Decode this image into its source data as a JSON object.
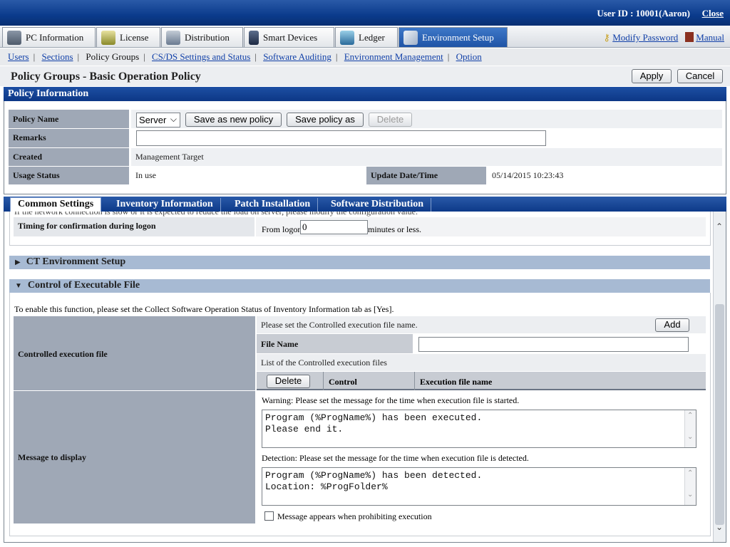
{
  "topbar": {
    "user_id": "User ID : 10001(Aaron)",
    "close": "Close"
  },
  "mainnav": {
    "tabs": [
      {
        "label": "PC Information",
        "icon": "pc-icon",
        "color": "#5a6a80"
      },
      {
        "label": "License",
        "icon": "license-icon",
        "color": "#7a8a2a"
      },
      {
        "label": "Distribution",
        "icon": "distribution-icon",
        "color": "#6a7a90"
      },
      {
        "label": "Smart Devices",
        "icon": "smart-device-icon",
        "color": "#2a3a5a"
      },
      {
        "label": "Ledger",
        "icon": "ledger-icon",
        "color": "#3a7aa8"
      },
      {
        "label": "Environment Setup",
        "icon": "tools-icon",
        "color": "#d8dde6"
      }
    ],
    "modify_password": "Modify Password",
    "manual": "Manual"
  },
  "subnav": {
    "items": [
      "Users",
      "Sections",
      "Policy Groups",
      "CS/DS Settings and Status",
      "Software Auditing",
      "Environment Management",
      "Option"
    ],
    "current": "Policy Groups"
  },
  "page": {
    "title": "Policy Groups - Basic Operation Policy",
    "apply": "Apply",
    "cancel": "Cancel"
  },
  "policy_info": {
    "header": "Policy Information",
    "policy_name_label": "Policy Name",
    "policy_name_value": "Server",
    "save_new": "Save as new policy",
    "save_as": "Save policy as",
    "delete": "Delete",
    "remarks_label": "Remarks",
    "remarks_value": "",
    "created_label": "Created",
    "created_value": "Management Target",
    "usage_label": "Usage Status",
    "usage_value": "In use",
    "update_label": "Update Date/Time",
    "update_value": "05/14/2015 10:23:43"
  },
  "tabs": [
    "Common Settings",
    "Inventory Information",
    "Patch Installation",
    "Software Distribution"
  ],
  "content": {
    "cut_text": "If the network connection is slow or it is expected to reduce the load on server, please modify the configuration value.",
    "timing_label": "Timing for confirmation during logon",
    "timing_prefix": "From logon",
    "timing_value": "0",
    "timing_suffix": "minutes or less.",
    "ct_env_header": "CT Environment Setup",
    "control_header": "Control of Executable File",
    "enable_note": "To enable this function, please set the Collect Software Operation Status of Inventory Information tab as [Yes].",
    "controlled_label": "Controlled execution file",
    "set_name_note": "Please set the Controlled execution file name.",
    "add": "Add",
    "file_name_label": "File Name",
    "file_name_value": "",
    "list_note": "List of the Controlled execution files",
    "list_delete": "Delete",
    "col_control": "Control",
    "col_exec": "Execution file name",
    "message_label": "Message to display",
    "warning_note": "Warning: Please set the message for the time when execution file is started.",
    "warning_text": "Program (%ProgName%) has been executed.\nPlease end it.",
    "detection_note": "Detection: Please set the message for the time when execution file is detected.",
    "detection_text": "Program (%ProgName%) has been detected.\nLocation: %ProgFolder%",
    "prohibit_label": "Message appears when prohibiting execution"
  }
}
